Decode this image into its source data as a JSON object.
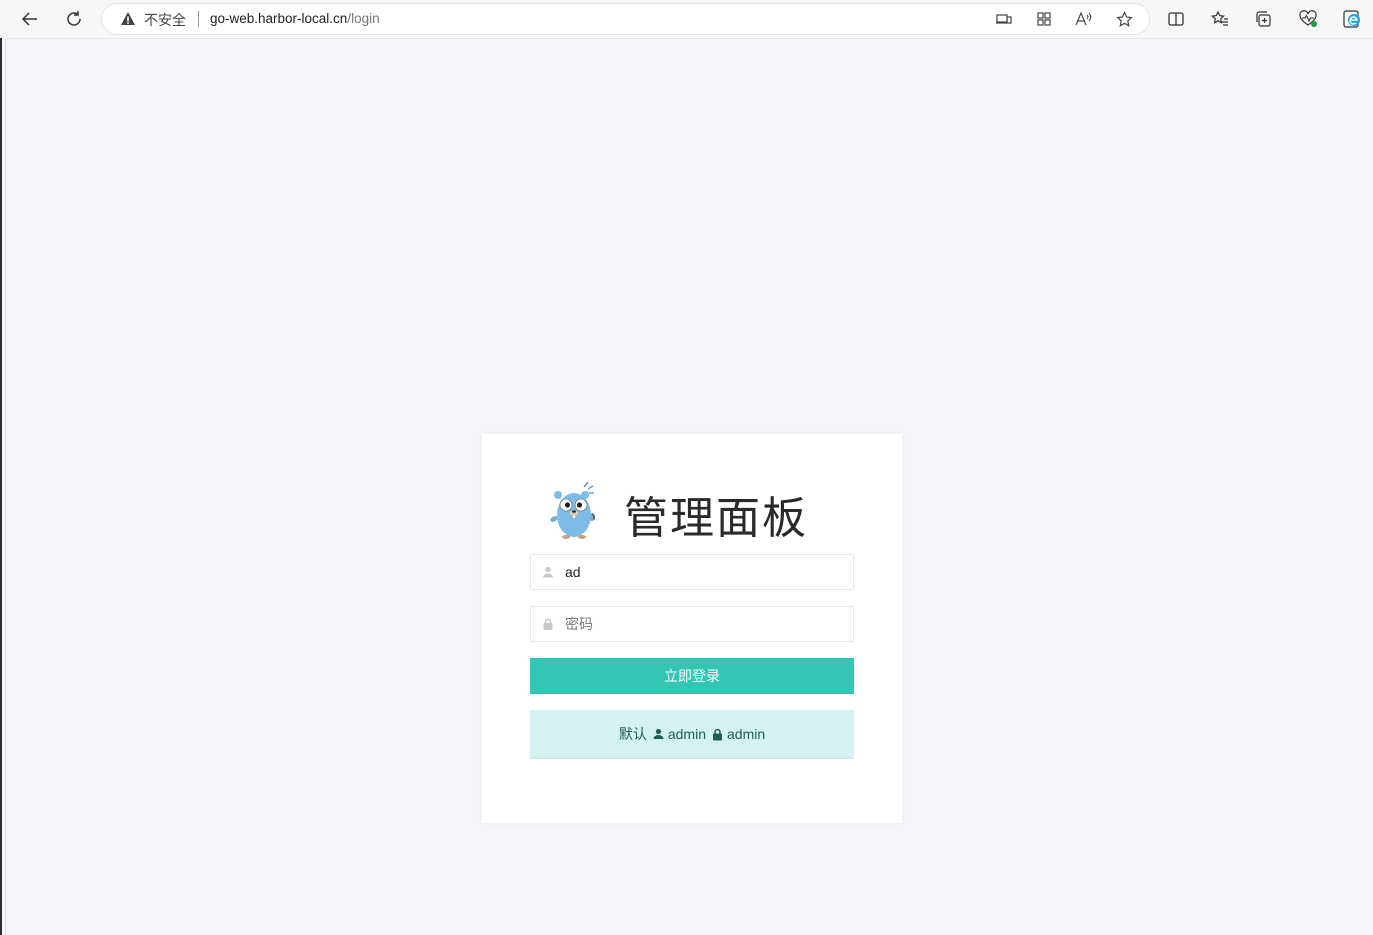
{
  "browser": {
    "insecure_label": "不安全",
    "url_host": "go-web.harbor-local.cn",
    "url_path": "/login"
  },
  "login": {
    "title": "管理面板",
    "username_value": "ad",
    "password_placeholder": "密码",
    "submit_label": "立即登录",
    "hint_prefix": "默认",
    "hint_user": "admin",
    "hint_pass": "admin"
  },
  "colors": {
    "accent": "#33c6b5",
    "hint_bg": "#d4f3f0",
    "page_bg": "#f4f5f8"
  }
}
